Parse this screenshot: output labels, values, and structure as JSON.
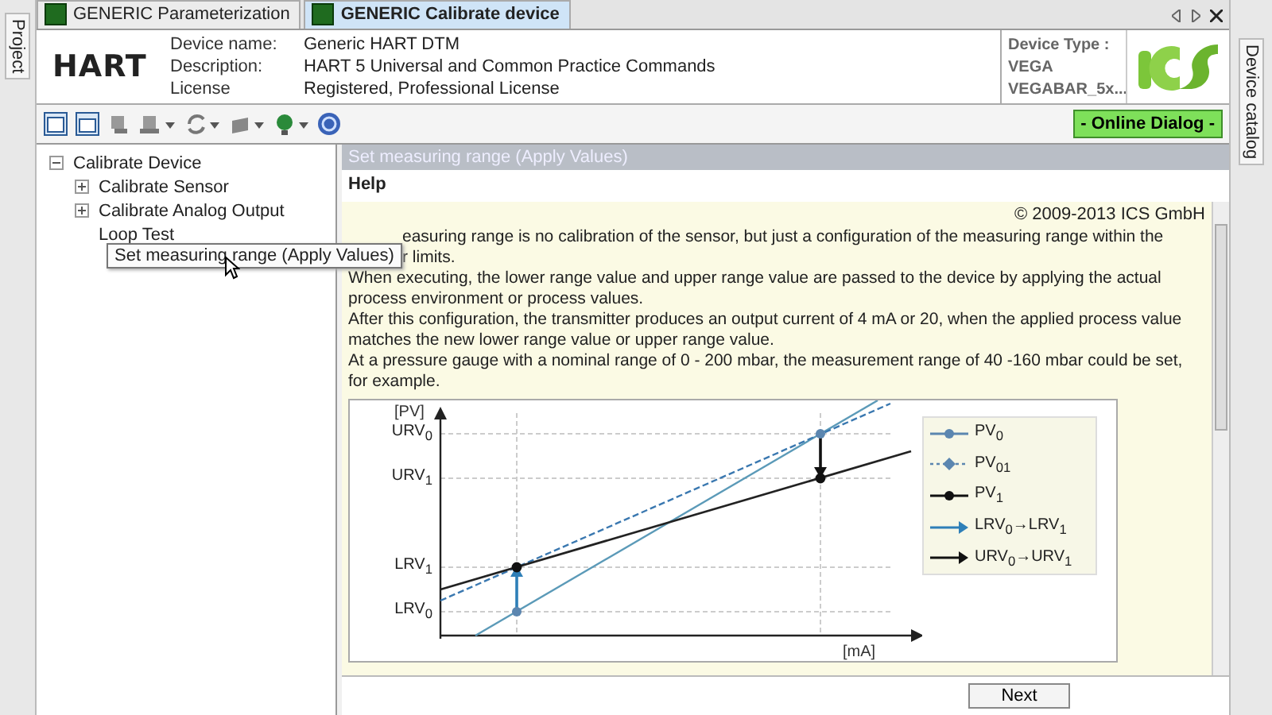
{
  "left_strip": {
    "label": "Project"
  },
  "right_strip": {
    "label": "Device catalog"
  },
  "tabs": [
    {
      "label": "GENERIC Parameterization",
      "selected": false
    },
    {
      "label": "GENERIC Calibrate device",
      "selected": true
    }
  ],
  "header": {
    "logo": "HART",
    "fields": [
      {
        "label": "Device name:",
        "value": "Generic HART DTM"
      },
      {
        "label": "Description:",
        "value": "HART 5 Universal and Common Practice Commands"
      },
      {
        "label": "License",
        "value": "Registered, Professional License"
      }
    ],
    "device_type": {
      "label": "Device Type :",
      "lines": [
        "VEGA",
        "VEGABAR_5x..."
      ]
    }
  },
  "online_button": "- Online Dialog -",
  "tree": [
    {
      "label": "Calibrate Device",
      "expanded": true,
      "children": [
        {
          "label": "Calibrate Sensor",
          "expanded": false
        },
        {
          "label": "Calibrate Analog Output",
          "expanded": false
        },
        {
          "label": "Loop Test"
        }
      ]
    }
  ],
  "tooltip": "Set measuring range (Apply Values)",
  "panel": {
    "title": "Set measuring range (Apply Values)",
    "heading": "Help",
    "copyright": "© 2009-2013 ICS GmbH",
    "lines": [
      {
        "text": "easuring range is no calibration of the sensor, but just a configuration of the measuring range within the",
        "covered": true
      },
      {
        "text": "r limits.",
        "covered": true
      },
      {
        "text": "When executing, the lower range value and upper range value are passed to the device by applying the actual",
        "covered": false
      },
      {
        "text": "process environment or process values.",
        "covered": false
      },
      {
        "text": "After this configuration, the transmitter produces an output current of 4 mA or 20, when the applied process value",
        "covered": false
      },
      {
        "text": "matches the new lower range value or upper range value.",
        "covered": false
      },
      {
        "text": "At a pressure gauge with a nominal range of 0 - 200 mbar, the measurement range of 40 -160 mbar could be set,",
        "covered": false
      },
      {
        "text": "for example.",
        "covered": false
      }
    ],
    "diagram": {
      "y_axis": "[PV]",
      "x_axis": "[mA]",
      "y_labels": [
        "URV$_{0}$",
        "URV$_{1}$",
        "LRV$_{1}$",
        "LRV$_{0}$"
      ],
      "legend": [
        {
          "kind": "dot",
          "label": "PV$_{0}$",
          "color": "#5b86b0"
        },
        {
          "kind": "diamond",
          "label": "PV$_{01}$",
          "color": "#5b86b0"
        },
        {
          "kind": "dot",
          "label": "PV$_{1}$",
          "color": "#111111"
        },
        {
          "kind": "arrow",
          "label": "LRV$_{0}$→LRV$_{1}$",
          "color": "#2e7fb8"
        },
        {
          "kind": "arrow",
          "label": "URV$_{0}$→URV$_{1}$",
          "color": "#111111"
        }
      ]
    },
    "next_button": "Next"
  }
}
